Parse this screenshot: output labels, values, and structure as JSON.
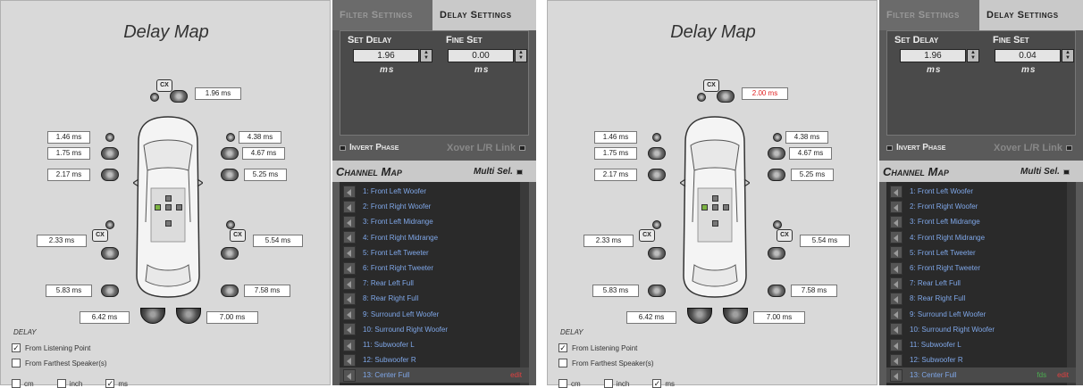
{
  "panels": [
    {
      "map": {
        "title": "Delay Map",
        "center_delay": "1.96 ms",
        "left_delays": [
          "1.46 ms",
          "1.75 ms",
          "2.17 ms",
          "2.33 ms",
          "5.83 ms"
        ],
        "right_delays": [
          "4.38 ms",
          "4.67 ms",
          "5.25 ms",
          "5.54 ms",
          "7.58 ms"
        ],
        "sub_left": "6.42 ms",
        "sub_right": "7.00 ms",
        "cx_label": "CX"
      },
      "tabs": {
        "filter": "Filter Settings",
        "delay": "Delay Settings"
      },
      "set_delay": {
        "label": "Set Delay",
        "value": "1.96",
        "unit": "ms"
      },
      "fine_set": {
        "label": "Fine Set",
        "value": "0.00",
        "unit": "ms"
      },
      "invert_phase": "Invert Phase",
      "xover_link": "Xover L/R Link",
      "channel_map": {
        "title": "Channel Map",
        "multi_sel": "Multi Sel."
      },
      "channels": [
        "1: Front Left Woofer",
        "2: Front Right Woofer",
        "3: Front Left Midrange",
        "4: Front Right Midrange",
        "5: Front Left Tweeter",
        "6: Front Right Tweeter",
        "7: Rear Left Full",
        "8: Rear Right Full",
        "9: Surround Left Woofer",
        "10: Surround Right Woofer",
        "11: Subwoofer L",
        "12: Subwoofer R",
        "13: Center Full"
      ],
      "selected_fds": "",
      "selected_edit": "edit"
    },
    {
      "map": {
        "title": "Delay Map",
        "center_delay": "2.00 ms",
        "left_delays": [
          "1.46 ms",
          "1.75 ms",
          "2.17 ms",
          "2.33 ms",
          "5.83 ms"
        ],
        "right_delays": [
          "4.38 ms",
          "4.67 ms",
          "5.25 ms",
          "5.54 ms",
          "7.58 ms"
        ],
        "sub_left": "6.42 ms",
        "sub_right": "7.00 ms",
        "cx_label": "CX"
      },
      "tabs": {
        "filter": "Filter Settings",
        "delay": "Delay Settings"
      },
      "set_delay": {
        "label": "Set Delay",
        "value": "1.96",
        "unit": "ms"
      },
      "fine_set": {
        "label": "Fine Set",
        "value": "0.04",
        "unit": "ms"
      },
      "invert_phase": "Invert Phase",
      "xover_link": "Xover L/R Link",
      "channel_map": {
        "title": "Channel Map",
        "multi_sel": "Multi Sel."
      },
      "channels": [
        "1: Front Left Woofer",
        "2: Front Right Woofer",
        "3: Front Left Midrange",
        "4: Front Right Midrange",
        "5: Front Left Tweeter",
        "6: Front Right Tweeter",
        "7: Rear Left Full",
        "8: Rear Right Full",
        "9: Surround Left Woofer",
        "10: Surround Right Woofer",
        "11: Subwoofer L",
        "12: Subwoofer R",
        "13: Center Full"
      ],
      "selected_fds": "fds",
      "selected_edit": "edit"
    }
  ],
  "delay_options": {
    "section_label": "DELAY",
    "from_listening_point": "From Listening Point",
    "from_farthest": "From Farthest Speaker(s)",
    "from_listening_checked": true,
    "from_farthest_checked": false
  },
  "units": {
    "cm": "cm",
    "inch": "inch",
    "ms": "ms",
    "cm_checked": false,
    "inch_checked": false,
    "ms_checked": true
  },
  "colors": {
    "accent_red": "#e02020",
    "channel_text": "#7fa7e8",
    "fds_green": "#4caf50"
  }
}
